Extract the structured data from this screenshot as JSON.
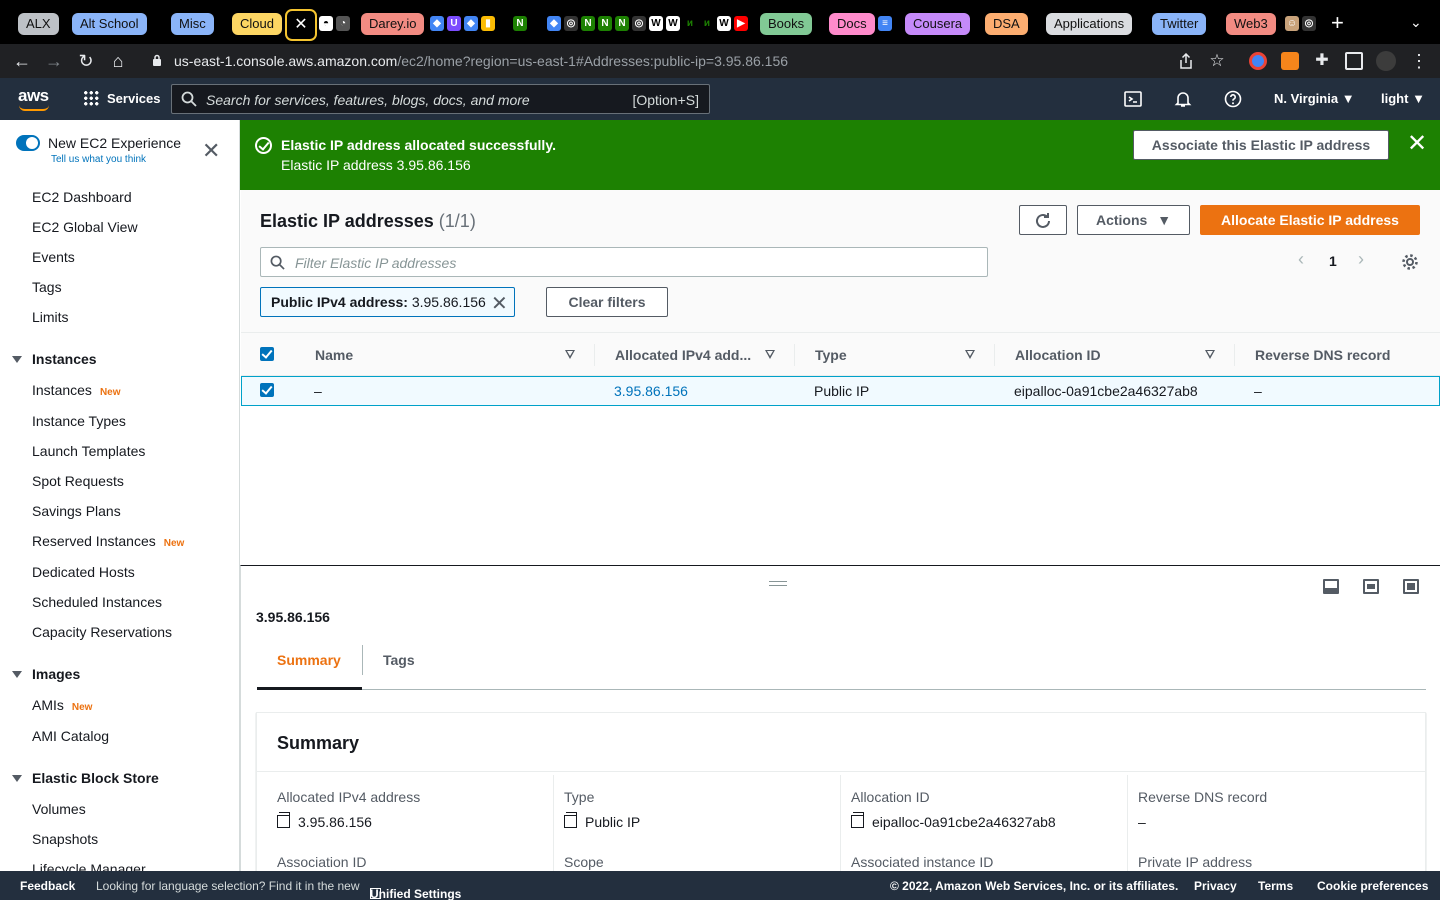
{
  "browser": {
    "tab_groups": [
      {
        "label": "ALX",
        "color": "#bdc1c6"
      },
      {
        "label": "Alt School",
        "color": "#8ab4f8"
      },
      {
        "label": "Misc",
        "color": "#8ab4f8"
      },
      {
        "label": "Cloud",
        "color": "#fdd663"
      },
      {
        "label": "Darey.io",
        "color": "#f28b82"
      },
      {
        "label": "Books",
        "color": "#81c995"
      },
      {
        "label": "Docs",
        "color": "#ff8bcb"
      },
      {
        "label": "Cousera",
        "color": "#c58af9"
      },
      {
        "label": "DSA",
        "color": "#fcad70"
      },
      {
        "label": "Applications",
        "color": "#dadce0"
      },
      {
        "label": "Twitter",
        "color": "#8ab4f8"
      },
      {
        "label": "Web3",
        "color": "#f28b82"
      }
    ],
    "active_tab_close": "✕",
    "url_host": "us-east-1.console.aws.amazon.com",
    "url_path": "/ec2/home?region=us-east-1#Addresses:public-ip=3.95.86.156"
  },
  "aws_nav": {
    "logo": "aws",
    "services_label": "Services",
    "search_placeholder": "Search for services, features, blogs, docs, and more",
    "search_shortcut": "[Option+S]",
    "region": "N. Virginia",
    "user": "light"
  },
  "sidebar": {
    "experience_title": "New EC2 Experience",
    "experience_link": "Tell us what you think",
    "top_items": [
      "EC2 Dashboard",
      "EC2 Global View",
      "Events",
      "Tags",
      "Limits"
    ],
    "sections": [
      {
        "title": "Instances",
        "items": [
          {
            "label": "Instances",
            "badge": "New"
          },
          {
            "label": "Instance Types",
            "badge": ""
          },
          {
            "label": "Launch Templates",
            "badge": ""
          },
          {
            "label": "Spot Requests",
            "badge": ""
          },
          {
            "label": "Savings Plans",
            "badge": ""
          },
          {
            "label": "Reserved Instances",
            "badge": "New"
          },
          {
            "label": "Dedicated Hosts",
            "badge": ""
          },
          {
            "label": "Scheduled Instances",
            "badge": ""
          },
          {
            "label": "Capacity Reservations",
            "badge": ""
          }
        ]
      },
      {
        "title": "Images",
        "items": [
          {
            "label": "AMIs",
            "badge": "New"
          },
          {
            "label": "AMI Catalog",
            "badge": ""
          }
        ]
      },
      {
        "title": "Elastic Block Store",
        "items": [
          {
            "label": "Volumes",
            "badge": ""
          },
          {
            "label": "Snapshots",
            "badge": ""
          },
          {
            "label": "Lifecycle Manager",
            "badge": ""
          }
        ]
      }
    ]
  },
  "flash": {
    "title": "Elastic IP address allocated successfully.",
    "message": "Elastic IP address 3.95.86.156",
    "action_label": "Associate this Elastic IP address"
  },
  "table": {
    "title": "Elastic IP addresses",
    "count": "(1/1)",
    "actions_label": "Actions",
    "allocate_label": "Allocate Elastic IP address",
    "filter_placeholder": "Filter Elastic IP addresses",
    "page_number": "1",
    "filter_chip_key": "Public IPv4 address:",
    "filter_chip_value": "3.95.86.156",
    "clear_filters_label": "Clear filters",
    "columns": [
      "Name",
      "Allocated IPv4 add...",
      "Type",
      "Allocation ID",
      "Reverse DNS record"
    ],
    "rows": [
      {
        "name": "–",
        "ipv4": "3.95.86.156",
        "type": "Public IP",
        "allocation_id": "eipalloc-0a91cbe2a46327ab8",
        "reverse_dns": "–"
      }
    ]
  },
  "details": {
    "title": "3.95.86.156",
    "tabs": [
      "Summary",
      "Tags"
    ],
    "active_tab": "Summary",
    "card_title": "Summary",
    "fields": [
      {
        "label": "Allocated IPv4 address",
        "value": "3.95.86.156",
        "copy": true
      },
      {
        "label": "Type",
        "value": "Public IP",
        "copy": true
      },
      {
        "label": "Allocation ID",
        "value": "eipalloc-0a91cbe2a46327ab8",
        "copy": true
      },
      {
        "label": "Reverse DNS record",
        "value": "–",
        "copy": false
      }
    ],
    "fields_row2": [
      "Association ID",
      "Scope",
      "Associated instance ID",
      "Private IP address"
    ]
  },
  "footer": {
    "feedback": "Feedback",
    "language_prompt": "Looking for language selection? Find it in the new",
    "unified_settings": "Unified Settings",
    "copyright": "© 2022, Amazon Web Services, Inc. or its affiliates.",
    "privacy": "Privacy",
    "terms": "Terms",
    "cookies": "Cookie preferences"
  }
}
